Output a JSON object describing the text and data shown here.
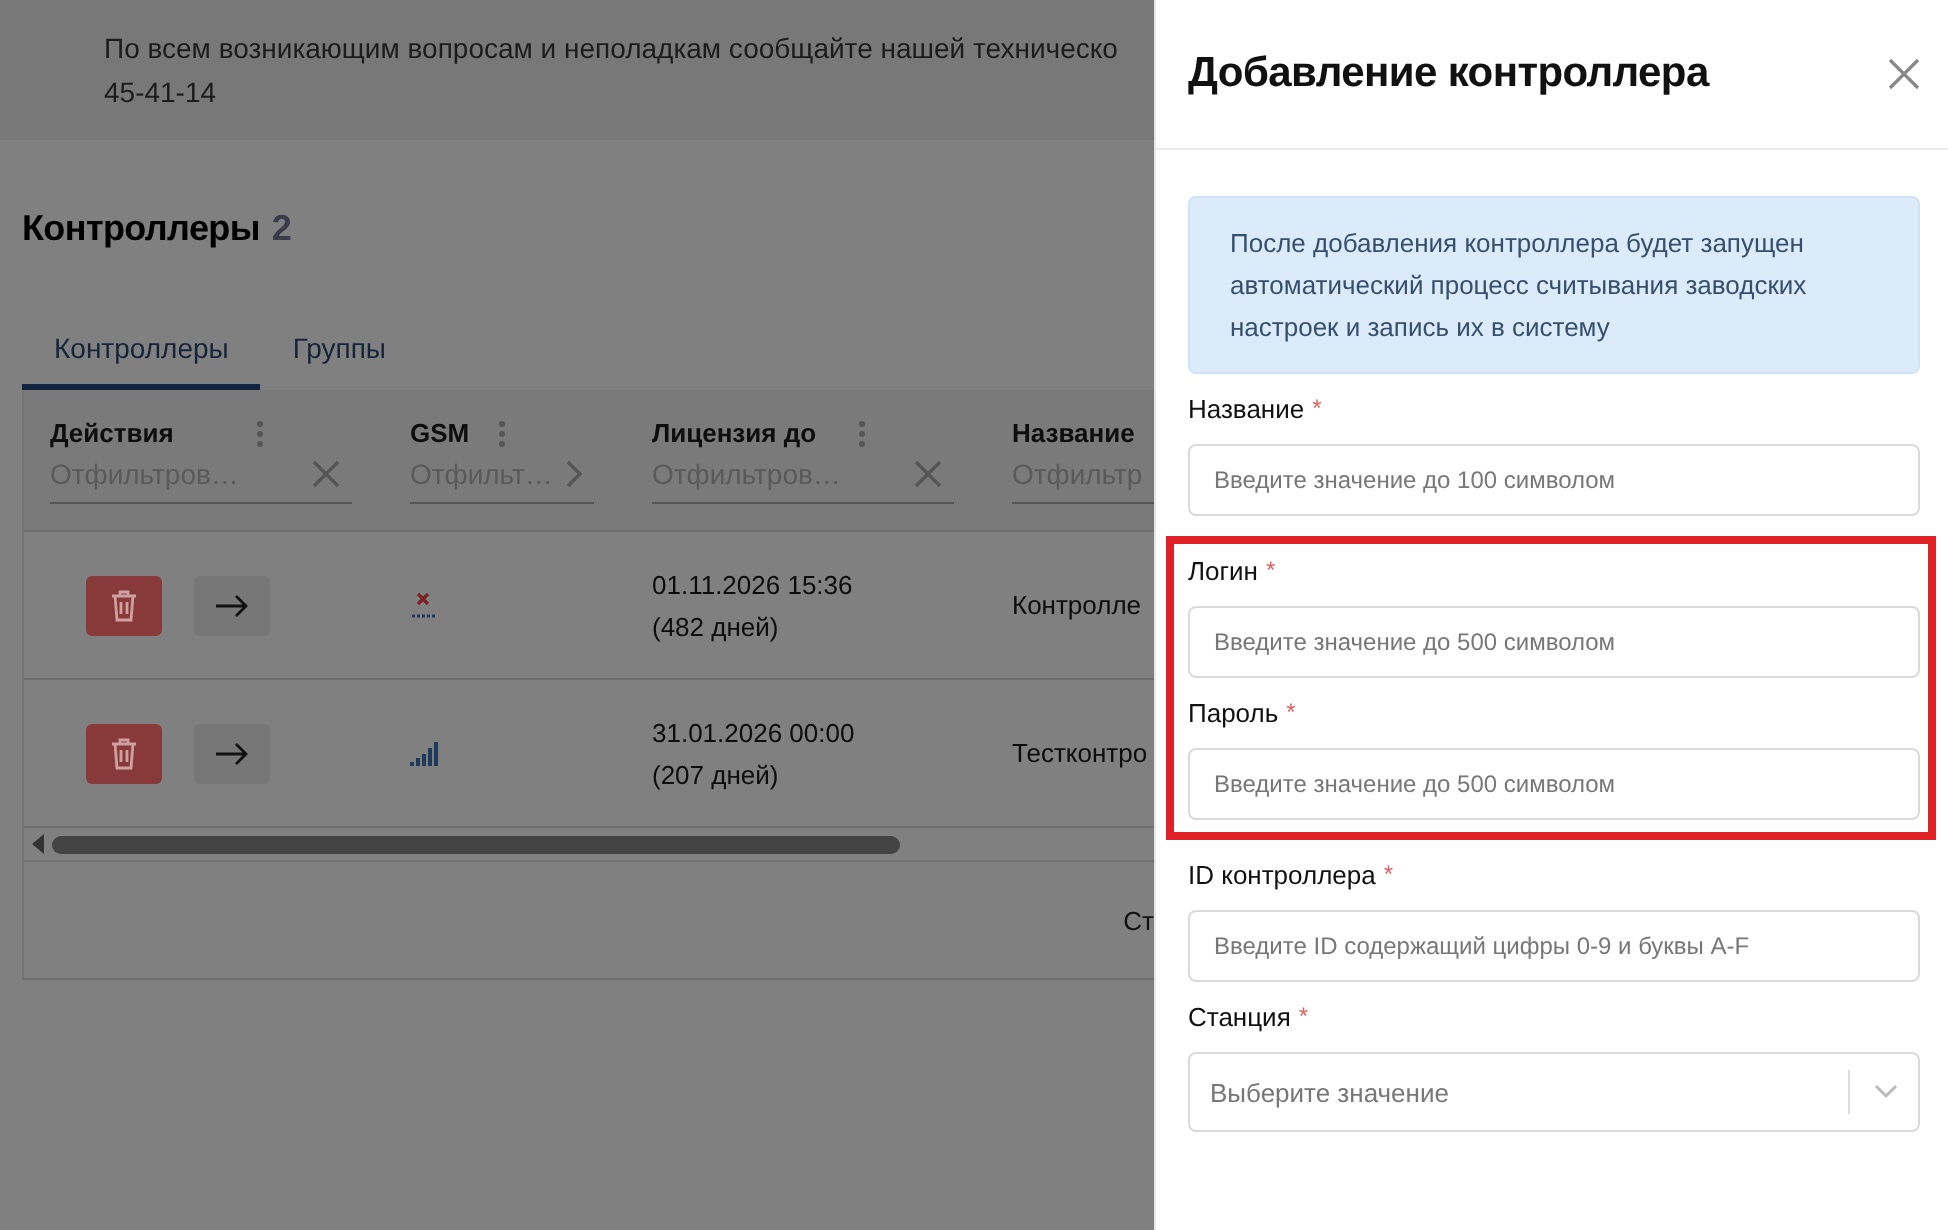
{
  "banner": {
    "text": "По всем возникающим вопросам и неполадкам сообщайте нашей техническо",
    "phone": "45-41-14"
  },
  "page": {
    "title": "Контроллеры",
    "count": "2"
  },
  "tabs": [
    {
      "label": "Контроллеры",
      "selected": true
    },
    {
      "label": "Группы",
      "selected": false
    }
  ],
  "table": {
    "columns": [
      {
        "title": "Действия",
        "filter": {
          "text": "Отфильтров…",
          "kind": "clear"
        },
        "menu": true
      },
      {
        "title": "GSM",
        "filter": {
          "text": "Отфильт…",
          "kind": "chevron"
        },
        "menu": true
      },
      {
        "title": "Лицензия до",
        "filter": {
          "text": "Отфильтров…",
          "kind": "clear"
        },
        "menu": true
      },
      {
        "title": "Название",
        "filter": {
          "text": "Отфильтр",
          "kind": "plain"
        },
        "menu": false
      }
    ],
    "rows": [
      {
        "gsm": {
          "kind": "no-signal"
        },
        "license_date": "01.11.2026 15:36",
        "license_days": "(482 дней)",
        "name": "Контролле"
      },
      {
        "gsm": {
          "kind": "signal"
        },
        "license_date": "31.01.2026 00:00",
        "license_days": "(207 дней)",
        "name": "Тестконтро"
      }
    ],
    "footer": "Ст"
  },
  "drawer": {
    "title": "Добавление контроллера",
    "info": "После добавления контроллера будет запущен автоматический процесс считывания заводских настроек и запись их в систему",
    "fields": [
      {
        "kind": "text",
        "label": "Название",
        "required_mark": "*",
        "placeholder": "Введите значение до 100 символом",
        "highlighted": false
      },
      {
        "kind": "text",
        "label": "Логин",
        "required_mark": "*",
        "placeholder": "Введите значение до 500 символом",
        "highlighted": true
      },
      {
        "kind": "text",
        "label": "Пароль",
        "required_mark": "*",
        "placeholder": "Введите значение до 500 символом",
        "highlighted": true
      },
      {
        "kind": "text",
        "label": "ID контроллера",
        "required_mark": "*",
        "placeholder": "Введите ID содержащий цифры 0-9 и буквы A-F",
        "highlighted": false
      },
      {
        "kind": "select",
        "label": "Станция",
        "required_mark": "*",
        "placeholder": "Выберите значение",
        "highlighted": false
      }
    ]
  }
}
